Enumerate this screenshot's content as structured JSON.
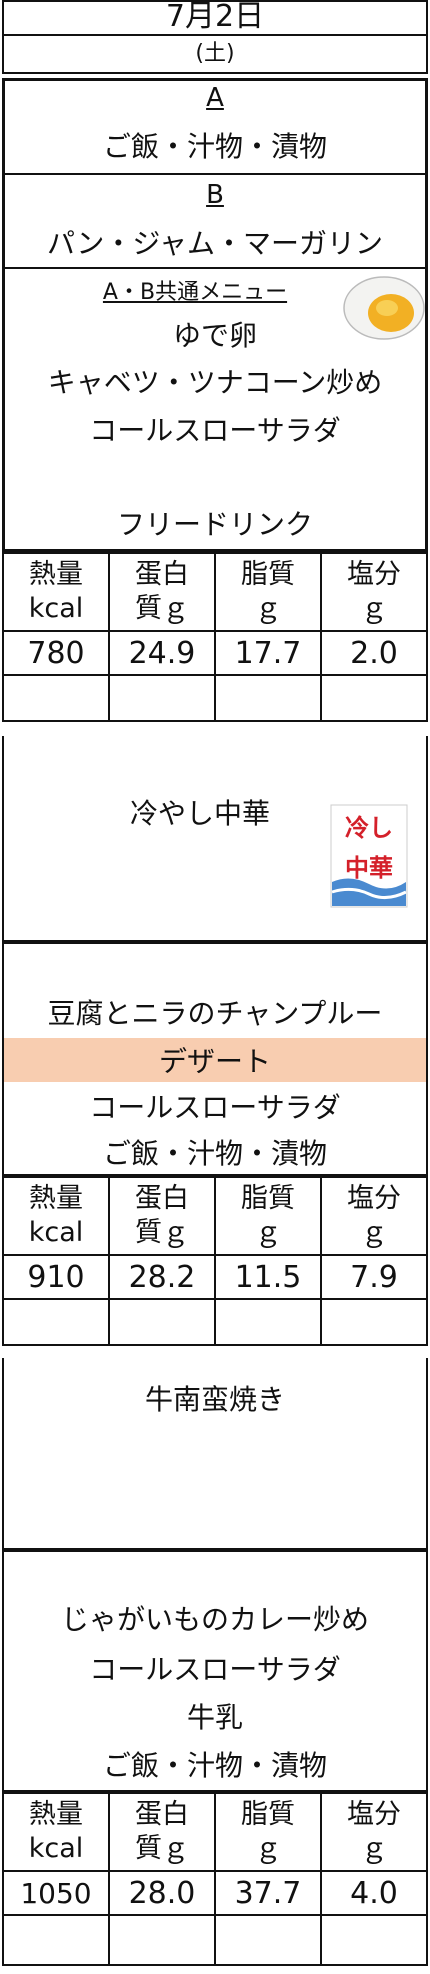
{
  "header": {
    "date": "7月2日",
    "day": "(土)"
  },
  "breakfast": {
    "a_label": "A",
    "a_menu": "ご飯・汁物・漬物",
    "b_label": "B",
    "b_menu": "パン・ジャム・マーガリン",
    "common_label": "A・B共通メニュー",
    "common_items": [
      "ゆで卵",
      "キャベツ・ツナコーン炒め",
      "コールスローサラダ"
    ],
    "drink": "フリードリンク",
    "nutrition_headers": [
      [
        "熱量",
        "kcal"
      ],
      [
        "蛋白",
        "質ｇ"
      ],
      [
        "脂質",
        "ｇ"
      ],
      [
        "塩分",
        "ｇ"
      ]
    ],
    "nutrition_values": [
      "780",
      "24.9",
      "17.7",
      "2.0"
    ]
  },
  "lunch": {
    "main": "冷やし中華",
    "side": "豆腐とニラのチャンプルー",
    "dessert": "デザート",
    "salad": "コールスローサラダ",
    "staple": "ご飯・汁物・漬物",
    "nutrition_values": [
      "910",
      "28.2",
      "11.5",
      "7.9"
    ],
    "sign_text": [
      "冷し",
      "中華"
    ]
  },
  "dinner": {
    "main": "牛南蛮焼き",
    "items": [
      "じゃがいものカレー炒め",
      "コールスローサラダ",
      "牛乳",
      "ご飯・汁物・漬物"
    ],
    "nutrition_values": [
      "1050",
      "28.0",
      "37.7",
      "4.0"
    ]
  },
  "colors": {
    "dessert_band": "#f8cdb0",
    "sign_red": "#d4202a",
    "sign_blue": "#4a8ad0",
    "egg_yolk": "#f2b024"
  },
  "icons": [
    "boiled-egg-icon",
    "hiyashi-chuka-sign-icon"
  ]
}
